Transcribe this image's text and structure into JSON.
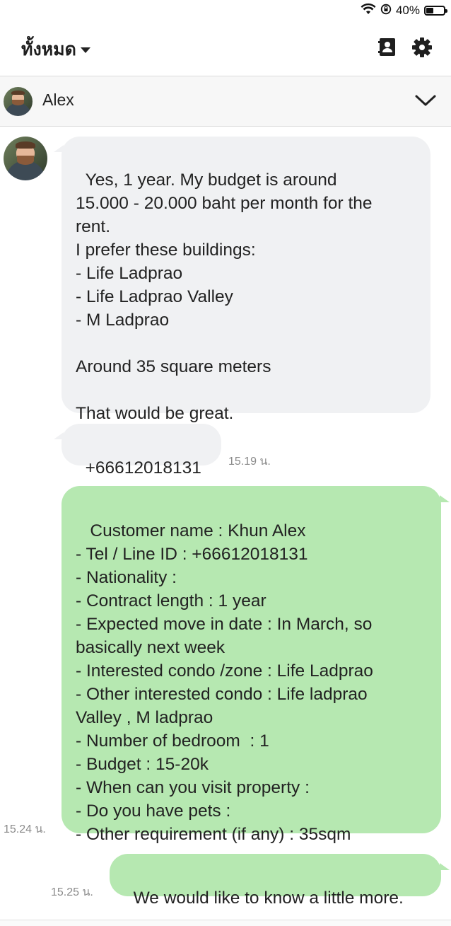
{
  "status_bar": {
    "battery_text": "40%",
    "battery_level": 0.4,
    "icons": [
      "wifi-icon",
      "orientation-lock-icon",
      "battery-icon"
    ]
  },
  "topbar": {
    "filter_label": "ทั้งหมด",
    "icons": [
      "contacts-icon",
      "settings-gear-icon"
    ]
  },
  "chat_header": {
    "contact_name": "Alex",
    "icons": [
      "chevron-down-icon"
    ]
  },
  "messages": [
    {
      "direction": "incoming",
      "text": "Yes, 1 year. My budget is around\n15.000 - 20.000 baht per month for the\nrent.\nI prefer these buildings:\n- Life Ladprao\n- Life Ladprao Valley\n- M Ladprao\n\nAround 35 square meters\n\nThat would be great.",
      "time": ""
    },
    {
      "direction": "incoming",
      "text": "+66612018131",
      "time": "15.19 น."
    },
    {
      "direction": "outgoing",
      "text": " Customer name : Khun Alex\n- Tel / Line ID : +66612018131\n- Nationality :\n- Contract length : 1 year\n- Expected move in date : In March, so\nbasically next week\n- Interested condo /zone : Life Ladprao\n- Other interested condo : Life ladprao\nValley , M ladprao\n- Number of bedroom  : 1\n- Budget : 15-20k\n- When can you visit property :\n- Do you have pets :\n- Other requirement (if any) : 35sqm",
      "time": "15.24 น."
    },
    {
      "direction": "outgoing",
      "text": "We would like to know a little more.",
      "time": "15.25 น."
    }
  ],
  "colors": {
    "incoming_bubble": "#f0f1f3",
    "outgoing_bubble": "#b6e8b1",
    "timestamp": "#8a8a8a"
  }
}
